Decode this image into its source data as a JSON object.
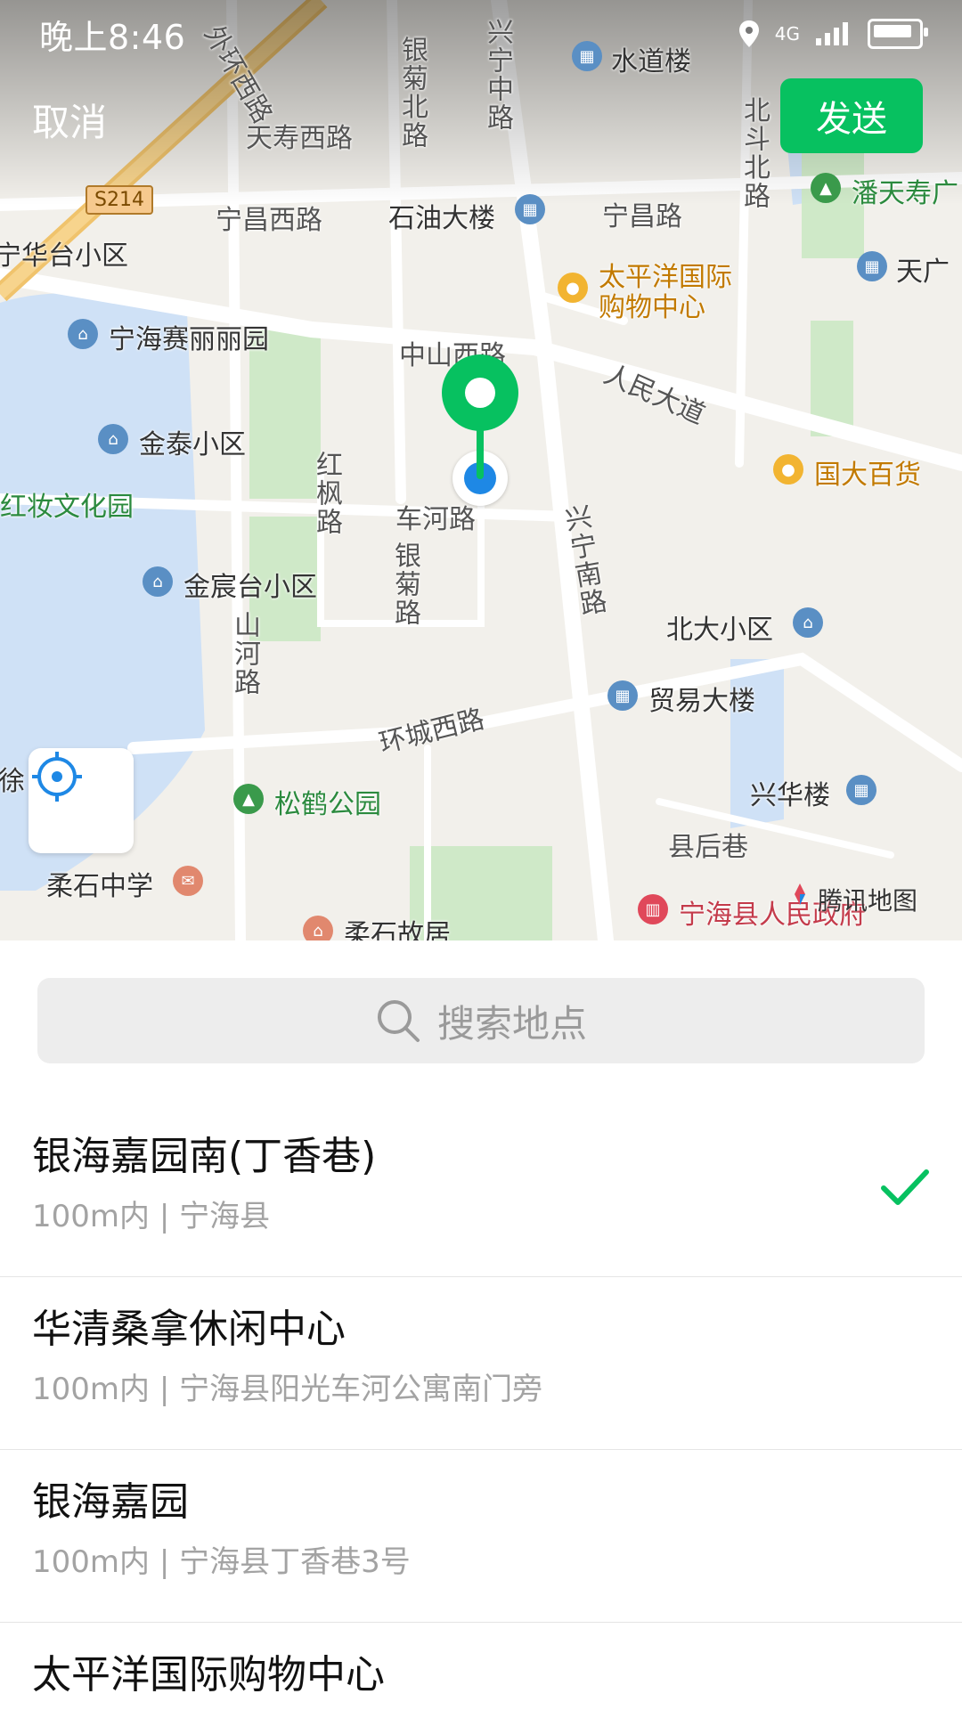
{
  "status": {
    "time": "晚上8:46",
    "network": "4G"
  },
  "header": {
    "cancel_label": "取消",
    "send_label": "发送"
  },
  "map": {
    "route_shield": "S214",
    "attribution": "腾讯地图",
    "roads": [
      "外环西路",
      "天寿西路",
      "银菊北路",
      "兴宁中路",
      "北斗北路",
      "宁昌西路",
      "宁昌路",
      "中山西路",
      "人民大道",
      "红枫路",
      "车河路",
      "银菊路",
      "兴宁南路",
      "山河路",
      "环城西路",
      "县后巷"
    ],
    "pois": [
      "水道楼",
      "潘天寿广",
      "石油大楼",
      "太平洋国际",
      "购物中心",
      "天广",
      "宁华台小区",
      "宁海赛丽丽园",
      "金泰小区",
      "国大百货",
      "红妆文化园",
      "金宸台小区",
      "北大小区",
      "贸易大楼",
      "兴华楼",
      "松鹤公园",
      "柔石中学",
      "柔石故居",
      "宁海县人民政府",
      "徐"
    ]
  },
  "search": {
    "placeholder": "搜索地点"
  },
  "results": [
    {
      "name": "银海嘉园南(丁香巷)",
      "detail": "100m内 | 宁海县",
      "selected": true
    },
    {
      "name": "华清桑拿休闲中心",
      "detail": "100m内 | 宁海县阳光车河公寓南门旁",
      "selected": false
    },
    {
      "name": "银海嘉园",
      "detail": "100m内 | 宁海县丁香巷3号",
      "selected": false
    },
    {
      "name": "太平洋国际购物中心",
      "detail": "",
      "selected": false
    }
  ],
  "colors": {
    "accent": "#07c160",
    "locate_blue": "#1e88e5",
    "map_bg": "#f2f0eb"
  }
}
